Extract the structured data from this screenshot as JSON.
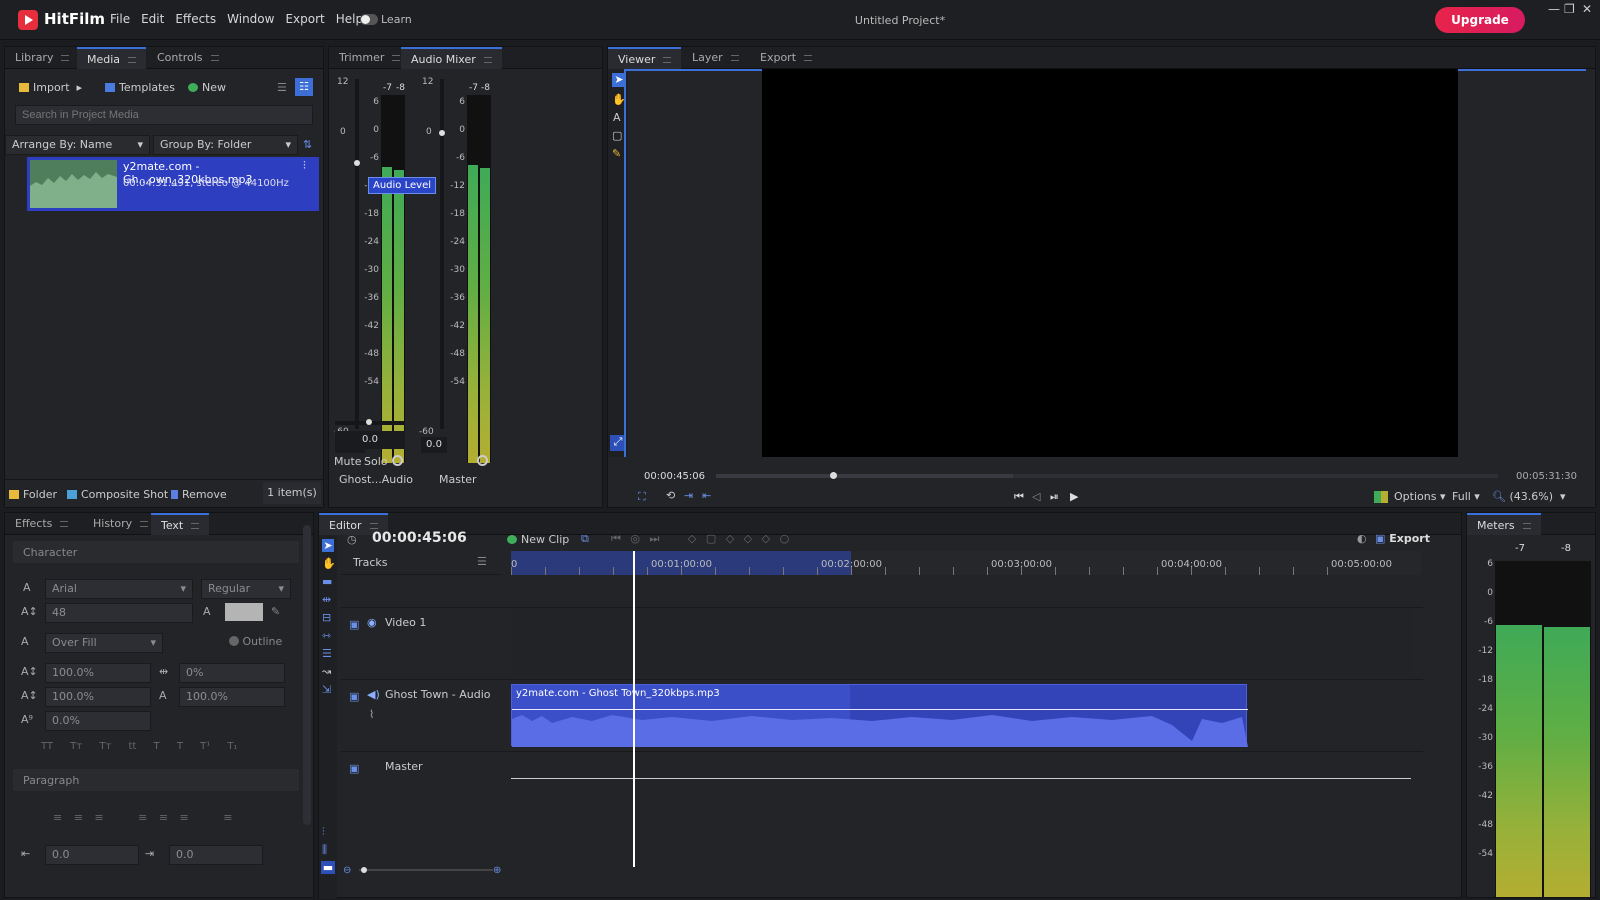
{
  "app": {
    "brand": "HitFilm",
    "menu": [
      "File",
      "Edit",
      "Effects",
      "Window",
      "Export",
      "Help"
    ],
    "learn": "Learn",
    "project_title": "Untitled Project*",
    "upgrade": "Upgrade"
  },
  "media_panel": {
    "tabs": [
      "Library",
      "Media",
      "Controls"
    ],
    "import": "Import",
    "templates": "Templates",
    "new": "New",
    "search_placeholder": "Search in Project Media",
    "arrange": "Arrange By: Name",
    "group": "Group By: Folder",
    "item": {
      "name": "y2mate.com - Gh...own_320kbps.mp3",
      "info": "00:04:31.491, stereo @ 44100Hz"
    },
    "footer": {
      "folder": "Folder",
      "composite": "Composite Shot",
      "remove": "Remove",
      "count": "1 item(s)"
    }
  },
  "mixer": {
    "tabs": [
      "Trimmer",
      "Audio Mixer"
    ],
    "ch1": {
      "top": "12",
      "zero": "0",
      "bottom": "-60",
      "value": "-7.0",
      "peak_l": "-7",
      "peak_r": "-8",
      "pan": "0.0",
      "name": "Ghost...Audio"
    },
    "ch2": {
      "top": "12",
      "zero": "0",
      "bottom": "-60",
      "value": "0.0",
      "peak_l": "-7",
      "peak_r": "-8",
      "name": "Master"
    },
    "tooltip": "Audio Level",
    "mute": "Mute",
    "solo": "Solo",
    "scale": [
      "6",
      "0",
      "-6",
      "-12",
      "-18",
      "-24",
      "-30",
      "-36",
      "-42",
      "-48",
      "-54"
    ]
  },
  "viewer": {
    "tabs": [
      "Viewer",
      "Layer",
      "Export"
    ],
    "time": "00:00:45:06",
    "duration": "00:05:31:30",
    "options": "Options",
    "full": "Full",
    "zoom": "(43.6%)",
    "progress": 0.149
  },
  "text_panel": {
    "tabs": [
      "Effects",
      "History",
      "Text"
    ],
    "character": "Character",
    "font": "Arial",
    "style": "Regular",
    "size": "48",
    "fill": "Over Fill",
    "outline": "Outline",
    "scale_h": "100.0%",
    "tracking": "0%",
    "scale_v": "100.0%",
    "leading": "100.0%",
    "baseline": "0.0%",
    "styles": [
      "TT",
      "Tт",
      "Tт",
      "tt",
      "T",
      "T",
      "T¹",
      "T₁"
    ],
    "paragraph": "Paragraph",
    "indent1": "0.0",
    "indent2": "0.0"
  },
  "editor": {
    "tab": "Editor",
    "time": "00:00:45:06",
    "new_clip": "New Clip",
    "export": "Export",
    "tracks": "Tracks",
    "ruler": [
      {
        "label": "00:01:00:00"
      },
      {
        "label": "00:02:00:00"
      },
      {
        "label": "00:03:00:00"
      },
      {
        "label": "00:04:00:00"
      },
      {
        "label": "00:05:00:00"
      }
    ],
    "video1": "Video 1",
    "audio_track": "Ghost Town - Audio",
    "clip": "y2mate.com - Ghost Town_320kbps.mp3",
    "master": "Master"
  },
  "meters": {
    "tab": "Meters",
    "peak_l": "-7",
    "peak_r": "-8",
    "scale": [
      "6",
      "0",
      "-6",
      "-12",
      "-18",
      "-24",
      "-30",
      "-36",
      "-42",
      "-48",
      "-54"
    ]
  },
  "colors": {
    "accent": "#3c6fd8",
    "clip": "#2f3fbf",
    "upgrade": "#e8244a"
  }
}
